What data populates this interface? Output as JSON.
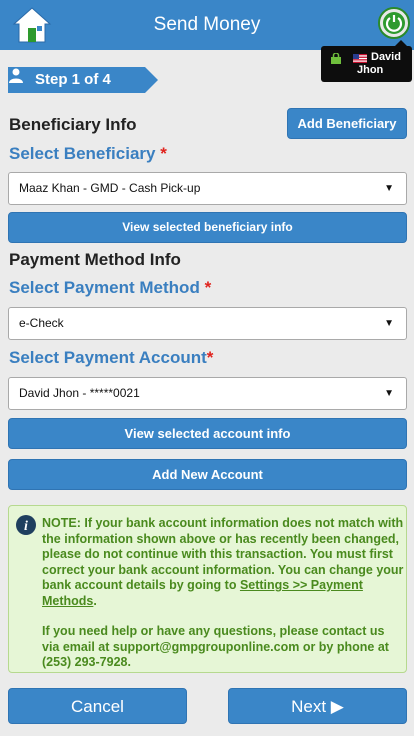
{
  "header": {
    "title": "Send Money",
    "home_icon": "home-icon",
    "power_icon": "power-icon"
  },
  "user": {
    "name": "David Jhon",
    "flag": "us-flag-icon"
  },
  "step": {
    "label": "Step 1 of 4"
  },
  "beneficiary": {
    "section_title": "Beneficiary Info",
    "add_button": "Add Beneficiary",
    "select_label": "Select Beneficiary",
    "required_mark": "*",
    "selected_value": "Maaz Khan - GMD - Cash Pick-up",
    "view_button": "View selected beneficiary info"
  },
  "payment": {
    "section_title": "Payment Method Info",
    "method_label": "Select Payment Method",
    "method_required": "*",
    "method_value": "e-Check",
    "account_label": "Select Payment Account",
    "account_required": "*",
    "account_value": "David Jhon - *****0021",
    "view_account_button": "View selected account info",
    "add_account_button": "Add New Account"
  },
  "note": {
    "p1_before": "NOTE: If your bank account information does not match with the information shown above or has recently been changed, please do not continue with this transaction. You must first correct your bank account information. You can change your bank account details by going to ",
    "p1_link": "Settings >> Payment Methods",
    "p1_after": ".",
    "p2": "If you need help or have any questions, please contact us via email at support@gmpgrouponline.com or by phone at (253) 293-7928."
  },
  "footer": {
    "cancel": "Cancel",
    "next": "Next ▶"
  },
  "colors": {
    "primary": "#3a86c8",
    "label": "#3a7fc0",
    "required": "#e0221c",
    "note_bg": "#e6f6d6",
    "note_text": "#4a8a1e"
  }
}
